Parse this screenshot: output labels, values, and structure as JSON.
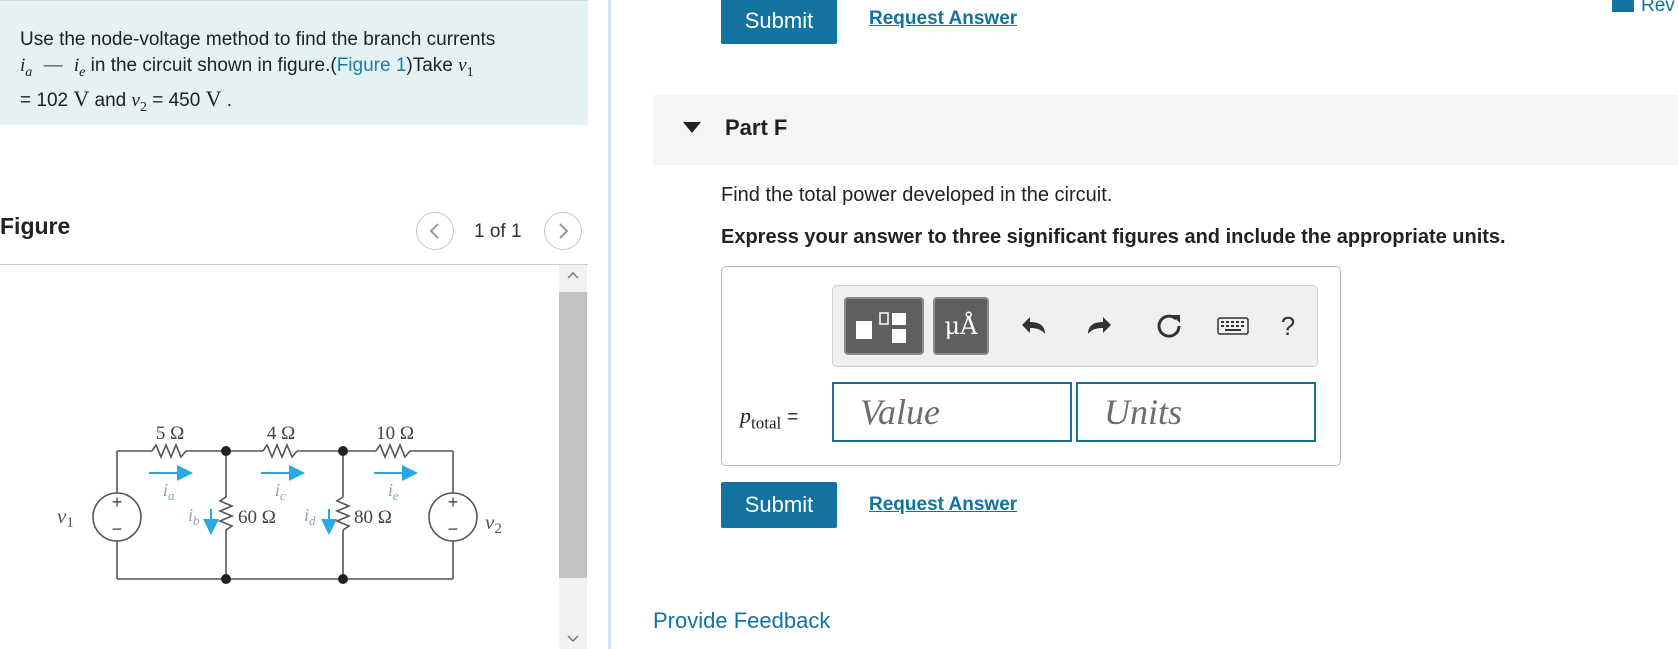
{
  "problem": {
    "text_1": "Use the node-voltage method to find the branch currents",
    "i_a": "i",
    "i_a_sub": "a",
    "dash": "—",
    "i_e": "i",
    "i_e_sub": "e",
    "text_2": "in the circuit shown in figure.(",
    "figure_link": "Figure 1",
    "text_3": ")Take",
    "v1": "v",
    "v1_sub": "1",
    "eq1": "= 102",
    "unit_V": "V",
    "and": "and",
    "v2": "v",
    "v2_sub": "2",
    "eq2": "= 450",
    "end": "."
  },
  "figure": {
    "title": "Figure",
    "counter": "1 of 1",
    "prev_icon": "chevron-left-icon",
    "next_icon": "chevron-right-icon",
    "circuit": {
      "r1": "5 Ω",
      "r2": "4 Ω",
      "r3": "10 Ω",
      "r4": "60 Ω",
      "r5": "80 Ω",
      "ia": "i",
      "ia_sub": "a",
      "ib": "i",
      "ib_sub": "b",
      "ic": "i",
      "ic_sub": "c",
      "id": "i",
      "id_sub": "d",
      "ie": "i",
      "ie_sub": "e",
      "v1": "v",
      "v1_sub": "1",
      "v2": "v",
      "v2_sub": "2",
      "plus": "+",
      "minus": "−",
      "arrow_color": "#29a9e0"
    }
  },
  "top_bar": {
    "submit": "Submit",
    "request": "Request Answer",
    "review": "Rev"
  },
  "part": {
    "title": "Part F",
    "question": "Find the total power developed in the circuit.",
    "instruction": "Express your answer to three significant figures and include the appropriate units.",
    "toolbar": {
      "symbols_label": "μÅ",
      "help": "?"
    },
    "var": "p",
    "var_sub": "total",
    "eq": "=",
    "value_placeholder": "Value",
    "units_placeholder": "Units",
    "submit": "Submit",
    "request": "Request Answer"
  },
  "feedback": "Provide Feedback",
  "colors": {
    "accent": "#12739f",
    "problem_bg": "#e4f2f4",
    "arrow": "#29a9e0"
  }
}
